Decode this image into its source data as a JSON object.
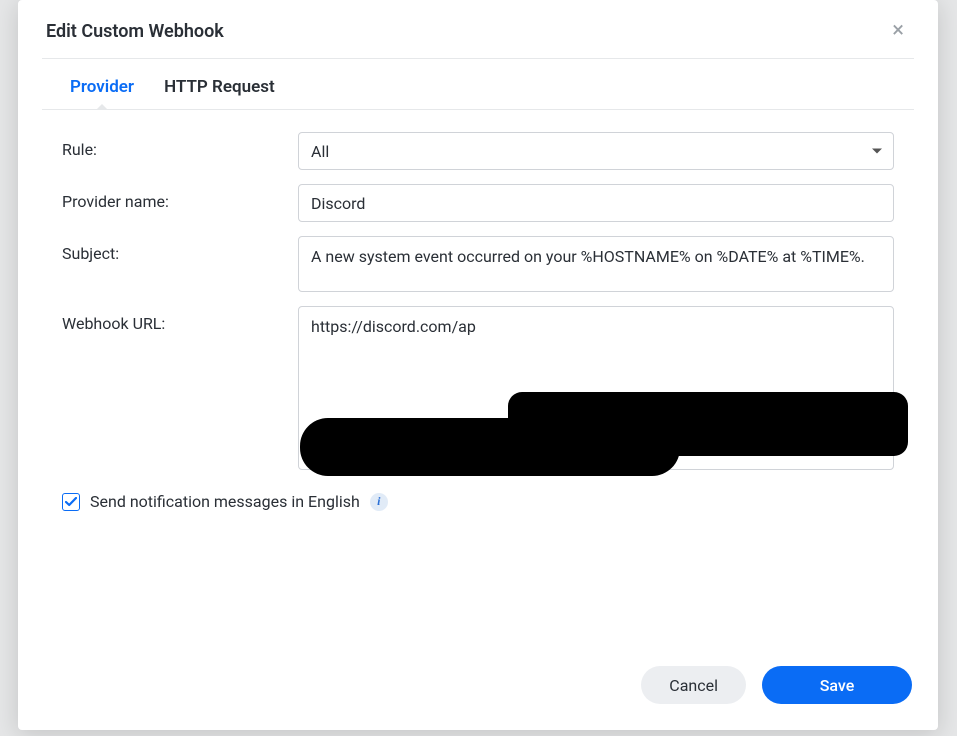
{
  "modal": {
    "title": "Edit Custom Webhook",
    "close_icon": "×"
  },
  "tabs": {
    "provider": "Provider",
    "http_request": "HTTP Request"
  },
  "form": {
    "rule_label": "Rule:",
    "rule_value": "All",
    "provider_name_label": "Provider name:",
    "provider_name_value": "Discord",
    "subject_label": "Subject:",
    "subject_value": "A new system event occurred on your %HOSTNAME% on %DATE% at %TIME%.",
    "webhook_url_label": "Webhook URL:",
    "webhook_url_value": "https://discord.com/ap"
  },
  "checkbox": {
    "checked": true,
    "label": "Send notification messages in English"
  },
  "footer": {
    "cancel": "Cancel",
    "save": "Save"
  }
}
